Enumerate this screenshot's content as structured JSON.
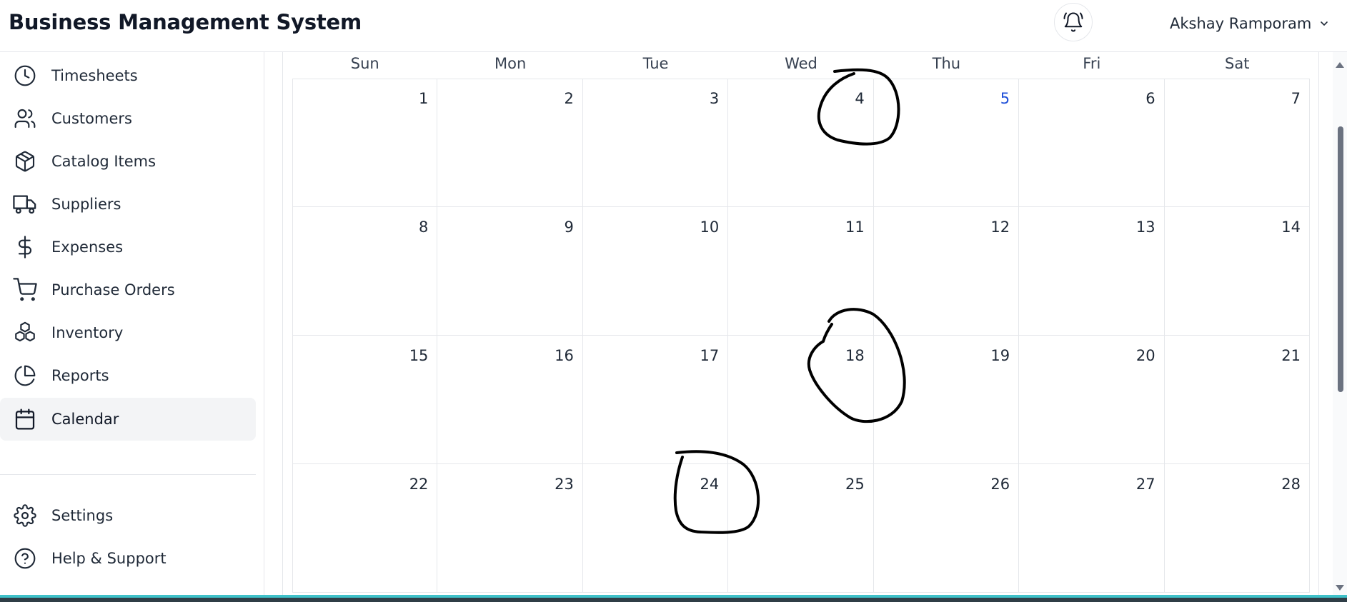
{
  "header": {
    "app_title": "Business Management System",
    "user_name": "Akshay Ramporam",
    "icons": {
      "notifications": "bell-icon",
      "user_menu": "chevron-down-icon"
    }
  },
  "sidebar": {
    "items": [
      {
        "label": "Timesheets",
        "icon": "clock-icon"
      },
      {
        "label": "Customers",
        "icon": "users-icon"
      },
      {
        "label": "Catalog Items",
        "icon": "cube-icon"
      },
      {
        "label": "Suppliers",
        "icon": "truck-icon"
      },
      {
        "label": "Expenses",
        "icon": "dollar-icon"
      },
      {
        "label": "Purchase Orders",
        "icon": "cart-icon"
      },
      {
        "label": "Inventory",
        "icon": "boxes-icon"
      },
      {
        "label": "Reports",
        "icon": "pie-chart-icon"
      },
      {
        "label": "Calendar",
        "icon": "calendar-icon",
        "active": true
      }
    ],
    "footer_items": [
      {
        "label": "Settings",
        "icon": "gear-icon"
      },
      {
        "label": "Help & Support",
        "icon": "help-circle-icon"
      }
    ]
  },
  "calendar": {
    "weekdays": [
      "Sun",
      "Mon",
      "Tue",
      "Wed",
      "Thu",
      "Fri",
      "Sat"
    ],
    "weeks": [
      [
        "1",
        "2",
        "3",
        "4",
        "5",
        "6",
        "7"
      ],
      [
        "8",
        "9",
        "10",
        "11",
        "12",
        "13",
        "14"
      ],
      [
        "15",
        "16",
        "17",
        "18",
        "19",
        "20",
        "21"
      ],
      [
        "22",
        "23",
        "24",
        "25",
        "26",
        "27",
        "28"
      ]
    ],
    "today": "5",
    "today_color": "#1d4ed8"
  },
  "annotations": {
    "circled_days": [
      "4",
      "18",
      "24"
    ]
  },
  "colors": {
    "accent_bottom": "#3fc1c9",
    "active_bg": "#f3f4f6"
  }
}
